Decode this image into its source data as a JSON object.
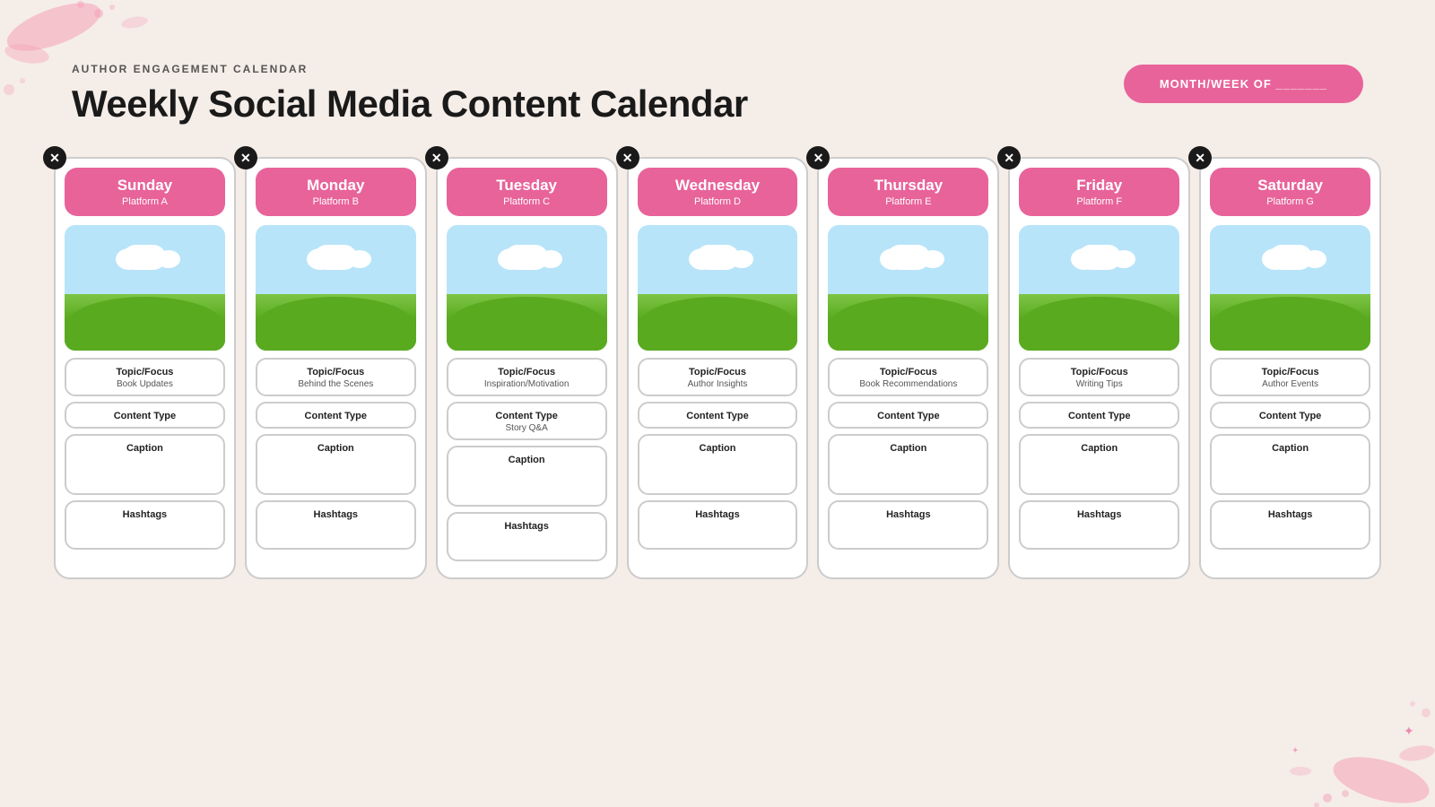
{
  "header": {
    "subtitle": "AUTHOR ENGAGEMENT CALENDAR",
    "title": "Weekly Social Media Content Calendar",
    "week_badge": "MONTH/WEEK OF _______"
  },
  "days": [
    {
      "id": "sunday",
      "name": "Sunday",
      "platform": "Platform A",
      "topic_label": "Topic/Focus",
      "topic_value": "Book Updates",
      "content_label": "Content Type",
      "content_value": "",
      "caption_label": "Caption",
      "hashtags_label": "Hashtags"
    },
    {
      "id": "monday",
      "name": "Monday",
      "platform": "Platform B",
      "topic_label": "Topic/Focus",
      "topic_value": "Behind the Scenes",
      "content_label": "Content Type",
      "content_value": "",
      "caption_label": "Caption",
      "hashtags_label": "Hashtags"
    },
    {
      "id": "tuesday",
      "name": "Tuesday",
      "platform": "Platform C",
      "topic_label": "Topic/Focus",
      "topic_value": "Inspiration/Motivation",
      "content_label": "Content Type",
      "content_value": "Story Q&A",
      "caption_label": "Caption",
      "hashtags_label": "Hashtags"
    },
    {
      "id": "wednesday",
      "name": "Wednesday",
      "platform": "Platform D",
      "topic_label": "Topic/Focus",
      "topic_value": "Author Insights",
      "content_label": "Content Type",
      "content_value": "",
      "caption_label": "Caption",
      "hashtags_label": "Hashtags"
    },
    {
      "id": "thursday",
      "name": "Thursday",
      "platform": "Platform E",
      "topic_label": "Topic/Focus",
      "topic_value": "Book Recommendations",
      "content_label": "Content Type",
      "content_value": "",
      "caption_label": "Caption",
      "hashtags_label": "Hashtags"
    },
    {
      "id": "friday",
      "name": "Friday",
      "platform": "Platform F",
      "topic_label": "Topic/Focus",
      "topic_value": "Writing Tips",
      "content_label": "Content Type",
      "content_value": "",
      "caption_label": "Caption",
      "hashtags_label": "Hashtags"
    },
    {
      "id": "saturday",
      "name": "Saturday",
      "platform": "Platform G",
      "topic_label": "Topic/Focus",
      "topic_value": "Author Events",
      "content_label": "Content Type",
      "content_value": "",
      "caption_label": "Caption",
      "hashtags_label": "Hashtags"
    }
  ],
  "colors": {
    "header_bg": "#e8639a",
    "border": "#cccccc",
    "bg": "#f5ede8"
  },
  "close_icon": "✕"
}
